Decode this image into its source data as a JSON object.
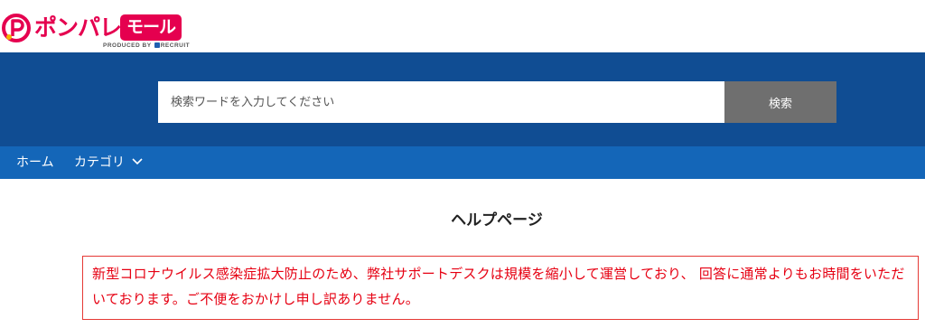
{
  "brand": {
    "name": "ポンパレ",
    "badge": "モール",
    "byline": "PRODUCED BY",
    "byline_company": "RECRUIT",
    "primary_color": "#e5004f"
  },
  "search": {
    "placeholder": "検索ワードを入力してください",
    "button_label": "検索",
    "band_color": "#104d93",
    "button_color": "#6f6f6f"
  },
  "nav": {
    "home_label": "ホーム",
    "category_label": "カテゴリ",
    "background": "#1466b8"
  },
  "main": {
    "title": "ヘルプページ",
    "notice": "新型コロナウイルス感染症拡大防止のため、弊社サポートデスクは規模を縮小して運営しており、 回答に通常よりもお時間をいただいております。ご不便をおかけし申し訳ありません。",
    "notice_color": "#e60012"
  }
}
